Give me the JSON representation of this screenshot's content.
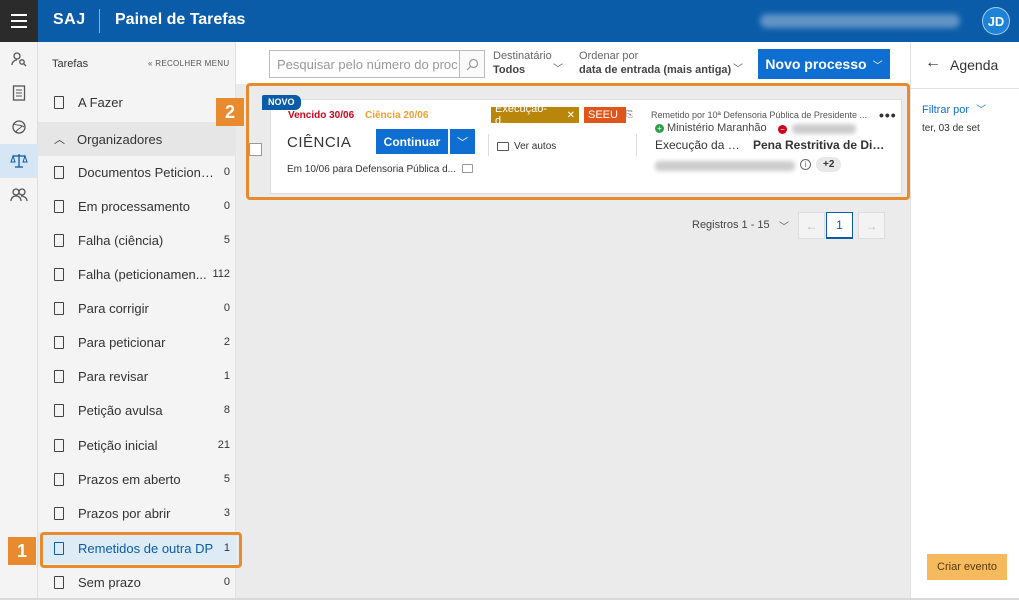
{
  "header": {
    "brand": "SAJ",
    "title": "Painel de Tarefas",
    "avatar_initials": "JD",
    "colors": {
      "bar": "#0b5ca8",
      "accent": "#0e6ed1",
      "highlight": "#e88a2e"
    }
  },
  "rail": {
    "icons": [
      "user-search-icon",
      "document-list-icon",
      "globe-icon",
      "scales-icon",
      "users-icon"
    ]
  },
  "sidebar": {
    "title": "Tarefas",
    "collapse_label": "« RECOLHER MENU",
    "todo_label": "A Fazer",
    "organizers_label": "Organizadores",
    "items": [
      {
        "label": "Documentos Peticiona...",
        "count": "0"
      },
      {
        "label": "Em processamento",
        "count": "0"
      },
      {
        "label": "Falha (ciência)",
        "count": "5"
      },
      {
        "label": "Falha (peticionamen...",
        "count": "112"
      },
      {
        "label": "Para corrigir",
        "count": "0"
      },
      {
        "label": "Para peticionar",
        "count": "2"
      },
      {
        "label": "Para revisar",
        "count": "1"
      },
      {
        "label": "Petição avulsa",
        "count": "8"
      },
      {
        "label": "Petição inicial",
        "count": "21"
      },
      {
        "label": "Prazos em aberto",
        "count": "5"
      },
      {
        "label": "Prazos por abrir",
        "count": "3"
      },
      {
        "label": "Remetidos de outra DP",
        "count": "1"
      },
      {
        "label": "Sem prazo",
        "count": "0"
      }
    ],
    "selected_index": 11
  },
  "toolbar": {
    "search_placeholder": "Pesquisar pelo número do proc",
    "recipient_label": "Destinatário",
    "recipient_value": "Todos",
    "order_label": "Ordenar por",
    "order_value": "data de entrada (mais antiga)",
    "new_process_label": "Novo processo"
  },
  "task": {
    "badge": "NOVO",
    "due": "Vencido 30/06",
    "science": "Ciência 20/06",
    "title": "CIÊNCIA",
    "continue_label": "Continuar",
    "description": "Em 10/06 para Defensoria Pública d...",
    "tags": [
      {
        "label": "Execução-d...",
        "color": "#b8860b"
      },
      {
        "label": "SEEU",
        "color": "#e0561a"
      }
    ],
    "open_records_label": "Ver autos",
    "sent_by": "Remetido por 10ª Defensoria Pública de Presidente ...",
    "party_active": "Ministério Maranhão",
    "class_label": "Execução da Pe...",
    "subject_label": "Pena Restritiva de Dire...",
    "extra_count": "+2"
  },
  "pagination": {
    "records_label": "Registros 1 - 15",
    "current_page": "1"
  },
  "agenda": {
    "title": "Agenda",
    "filter_label": "Filtrar por",
    "date_label": "ter, 03 de set",
    "create_event_label": "Criar evento"
  },
  "annotations": {
    "marker_1": "1",
    "marker_2": "2"
  }
}
